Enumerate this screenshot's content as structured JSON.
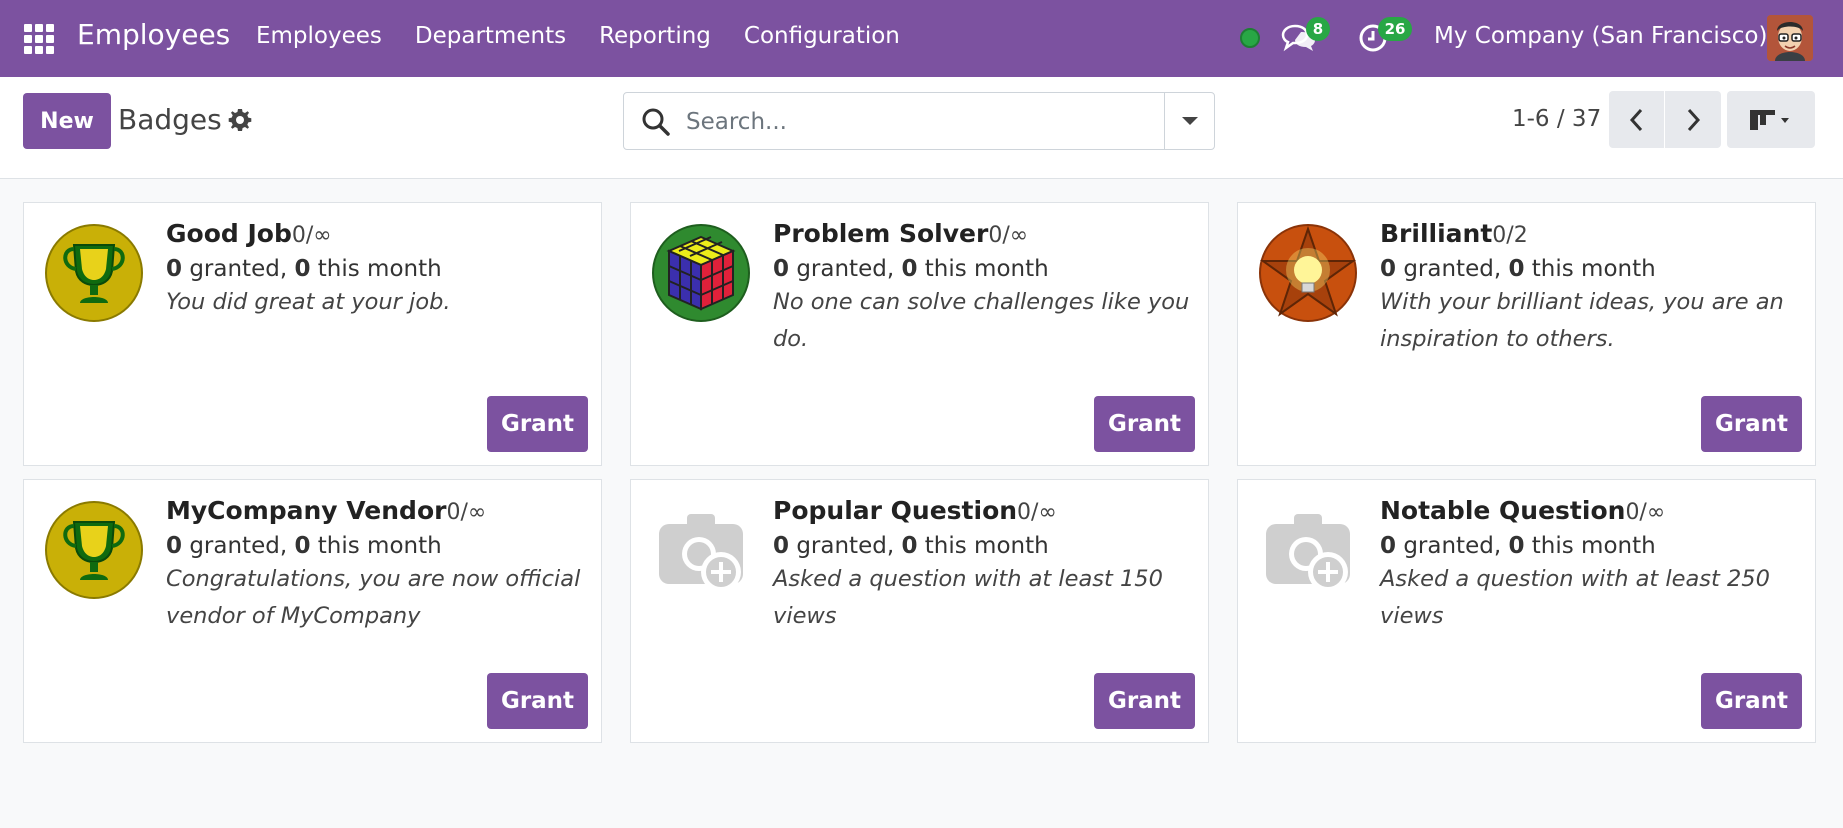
{
  "navbar": {
    "app_name": "Employees",
    "menu": [
      "Employees",
      "Departments",
      "Reporting",
      "Configuration"
    ],
    "messages_count": "8",
    "activities_count": "26",
    "company": "My Company (San Francisco)"
  },
  "control": {
    "new_label": "New",
    "title": "Badges",
    "search_placeholder": "Search...",
    "pager": "1-6 / 37"
  },
  "badges": [
    {
      "name": "Good Job",
      "limit": "0/∞",
      "granted": "0",
      "month": "0",
      "granted_text": " granted, ",
      "month_text": " this month",
      "description": "You did great at your job.",
      "icon": "trophy-icon",
      "grant_label": "Grant"
    },
    {
      "name": "Problem Solver",
      "limit": "0/∞",
      "granted": "0",
      "month": "0",
      "granted_text": " granted, ",
      "month_text": " this month",
      "description": "No one can solve challenges like you do.",
      "icon": "rubiks-cube-icon",
      "grant_label": "Grant"
    },
    {
      "name": "Brilliant",
      "limit": "0/2",
      "granted": "0",
      "month": "0",
      "granted_text": " granted, ",
      "month_text": " this month",
      "description": "With your brilliant ideas, you are an inspiration to others.",
      "icon": "lightbulb-star-icon",
      "grant_label": "Grant"
    },
    {
      "name": "MyCompany Vendor",
      "limit": "0/∞",
      "granted": "0",
      "month": "0",
      "granted_text": " granted, ",
      "month_text": " this month",
      "description": "Congratulations, you are now official vendor of MyCompany",
      "icon": "trophy-icon",
      "grant_label": "Grant"
    },
    {
      "name": "Popular Question",
      "limit": "0/∞",
      "granted": "0",
      "month": "0",
      "granted_text": " granted, ",
      "month_text": " this month",
      "description": "Asked a question with at least 150 views",
      "icon": "camera-placeholder-icon",
      "grant_label": "Grant"
    },
    {
      "name": "Notable Question",
      "limit": "0/∞",
      "granted": "0",
      "month": "0",
      "granted_text": " granted, ",
      "month_text": " this month",
      "description": "Asked a question with at least 250 views",
      "icon": "camera-placeholder-icon",
      "grant_label": "Grant"
    }
  ],
  "colors": {
    "brand": "#7c52a0",
    "badge_green": "#28a745"
  }
}
